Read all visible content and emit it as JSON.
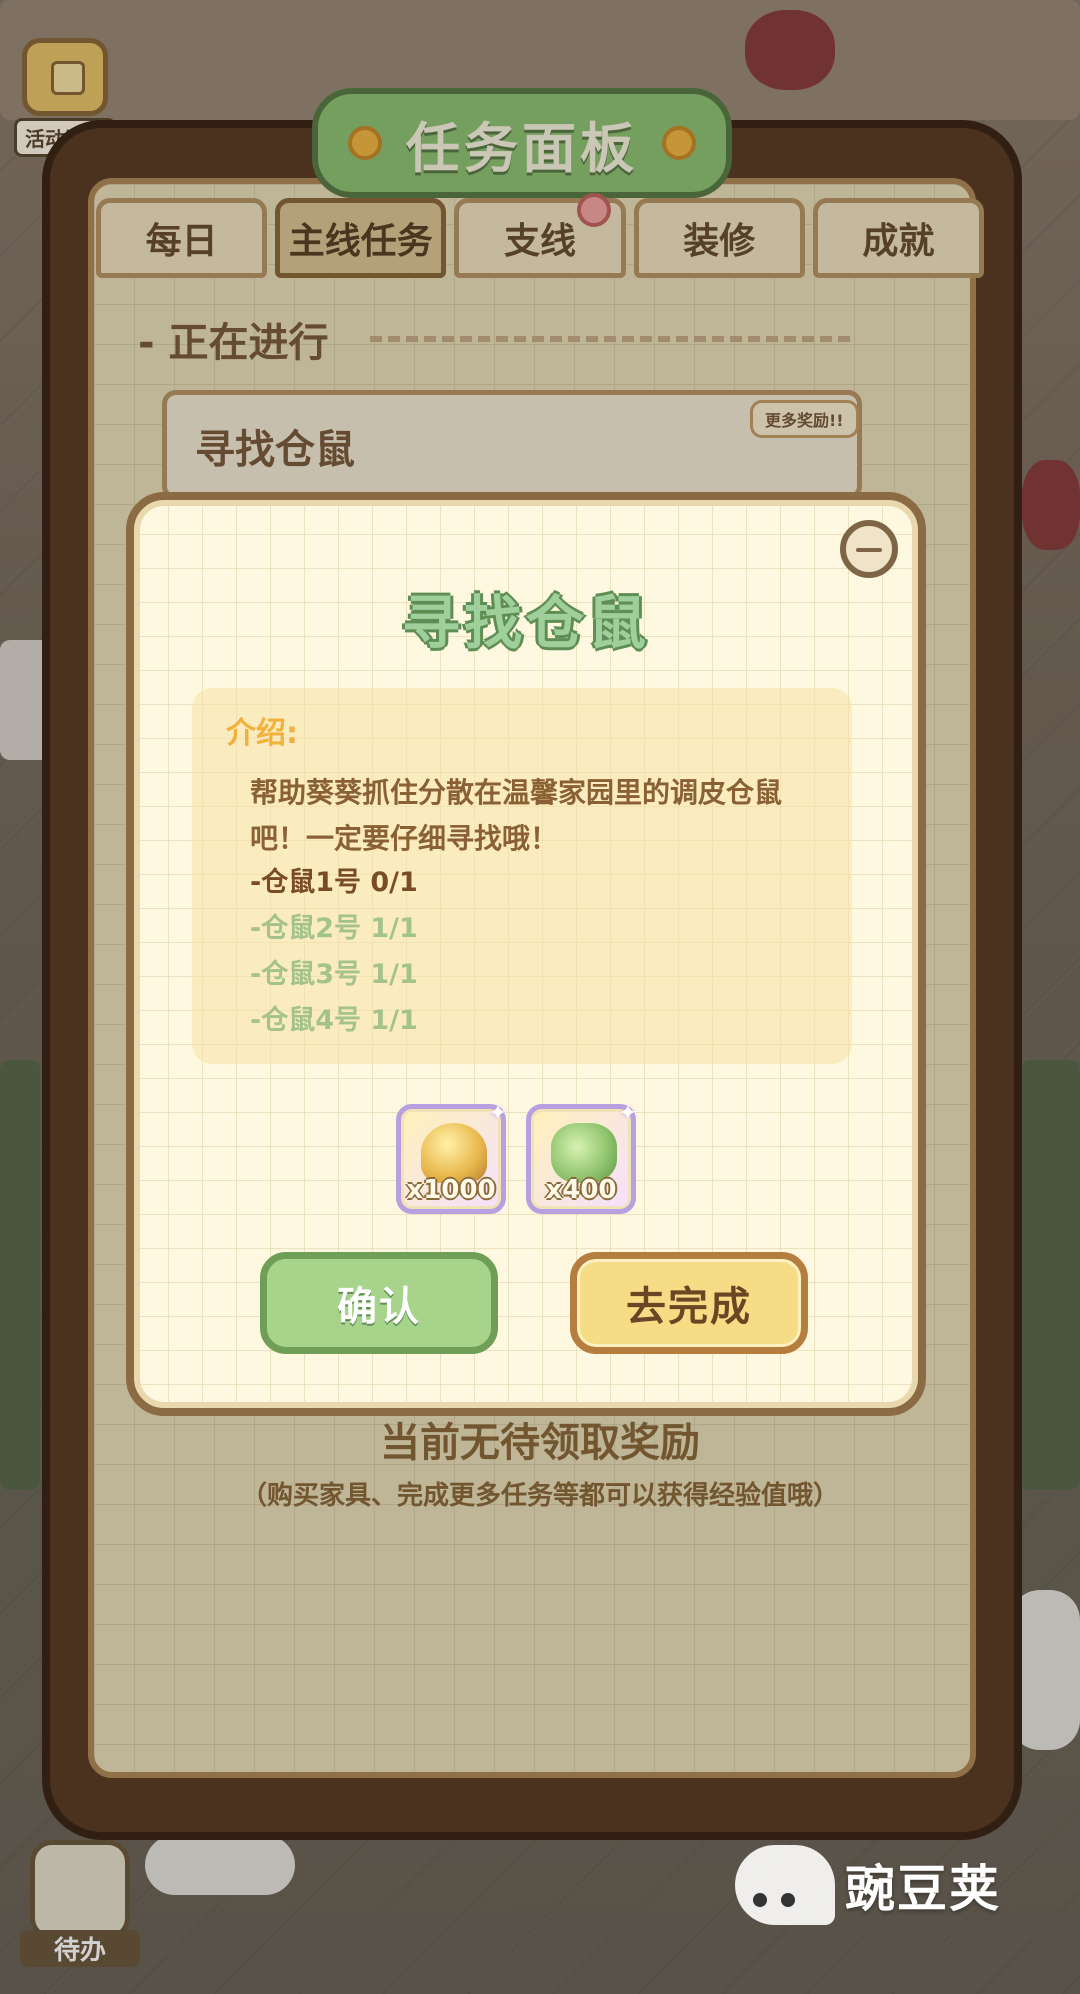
{
  "hud": {
    "activity_summary_label": "活动汇总",
    "todo_label": "待办"
  },
  "panel": {
    "title": "任务面板",
    "tabs": [
      {
        "label": "每日",
        "active": false
      },
      {
        "label": "主线任务",
        "active": true
      },
      {
        "label": "支线",
        "active": false,
        "badge": true
      },
      {
        "label": "装修",
        "active": false
      },
      {
        "label": "成就",
        "active": false
      }
    ],
    "section_title": "- 正在进行",
    "task_title": "寻找仓鼠",
    "more_rewards": "更多奖励!!",
    "status_main": "当前无待领取奖励",
    "status_sub": "（购买家具、完成更多任务等都可以获得经验值哦）"
  },
  "dialog": {
    "title": "寻找仓鼠",
    "intro_label": "介绍:",
    "description": "帮助葵葵抓住分散在温馨家园里的调皮仓鼠吧！一定要仔细寻找哦！",
    "goals": [
      {
        "text": "-仓鼠1号 0/1",
        "done": false
      },
      {
        "text": "-仓鼠2号 1/1",
        "done": true
      },
      {
        "text": "-仓鼠3号 1/1",
        "done": true
      },
      {
        "text": "-仓鼠4号 1/1",
        "done": true
      }
    ],
    "rewards": [
      {
        "icon": "coin-pile-icon",
        "qty": "x1000"
      },
      {
        "icon": "experience-leaf-icon",
        "qty": "x400"
      }
    ],
    "confirm_label": "确认",
    "go_label": "去完成"
  },
  "watermark": {
    "text": "豌豆荚"
  },
  "colors": {
    "dialog_title_green": "#9fd09c",
    "confirm_green": "#a8d38a",
    "go_yellow": "#f7dc86",
    "intro_orange": "#f2b03d",
    "panel_brown": "#5c3d25"
  }
}
